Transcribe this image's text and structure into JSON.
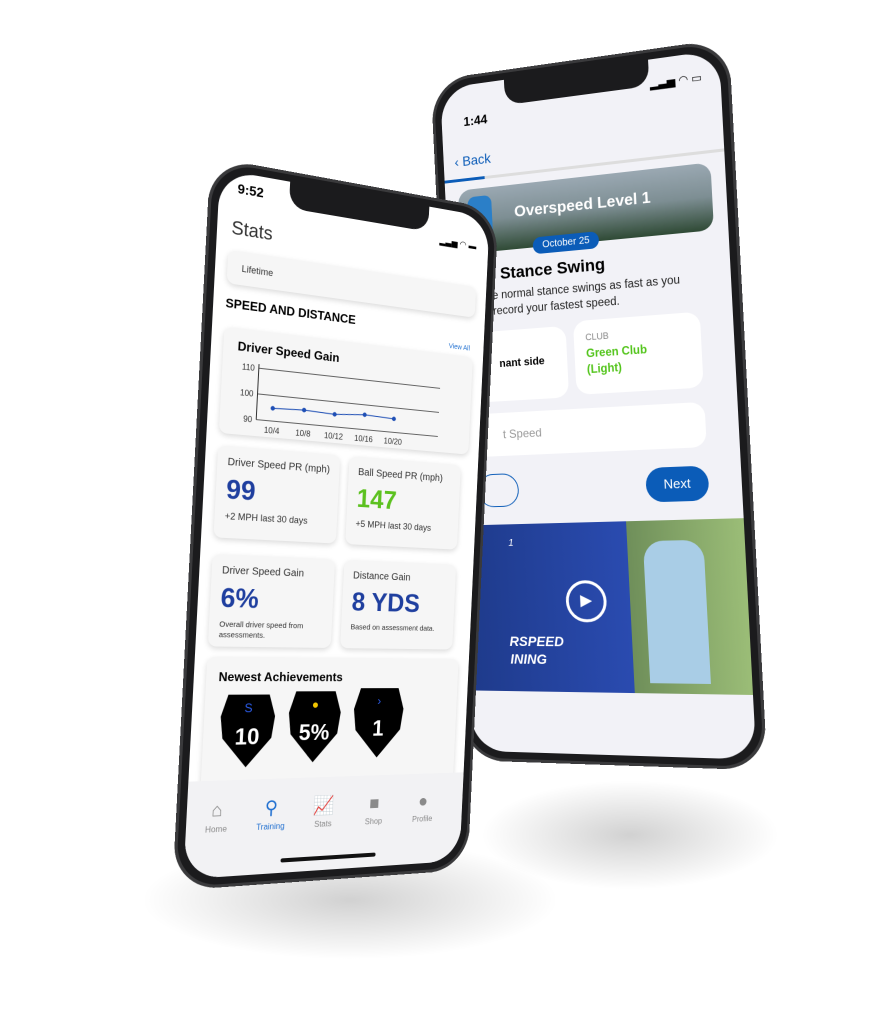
{
  "stats_phone": {
    "status": {
      "time": "9:52"
    },
    "title": "Stats",
    "period_selector": "Lifetime",
    "section_title": "SPEED AND DISTANCE",
    "view_all": "View All",
    "chart_card_title": "Driver Speed Gain",
    "chart_data": {
      "type": "line",
      "x": [
        "10/4",
        "10/8",
        "10/12",
        "10/16",
        "10/20"
      ],
      "values": [
        95,
        95.5,
        95,
        96,
        95.5
      ],
      "yticks": [
        "110",
        "100",
        "90"
      ],
      "ylim": [
        90,
        110
      ],
      "grid": true,
      "color": "#1f4fb5"
    },
    "cards": [
      {
        "label": "Driver Speed PR (mph)",
        "value": "99",
        "note": "+2 MPH last 30 days",
        "color": "#1f3f9f"
      },
      {
        "label": "Ball Speed PR (mph)",
        "value": "147",
        "note": "+5 MPH last 30 days",
        "color": "#5cc11f"
      },
      {
        "label": "Driver Speed Gain",
        "value": "6%",
        "note": "Overall driver speed from assessments.",
        "color": "#1f3f9f"
      },
      {
        "label": "Distance Gain",
        "value": "8 YDS",
        "note": "Based on assessment data.",
        "color": "#1f3f9f"
      }
    ],
    "achievements_title": "Newest Achievements",
    "achievements": [
      {
        "value": "10",
        "icon": "swirl-icon",
        "color": "#2d5ff0"
      },
      {
        "value": "5%",
        "icon": "bomb-icon",
        "color": "#f2c500"
      },
      {
        "value": "1",
        "icon": "chevron-icon",
        "color": "#2d5ff0"
      }
    ],
    "tabs": [
      {
        "label": "Home",
        "icon": "home-icon",
        "active": false
      },
      {
        "label": "Training",
        "icon": "training-icon",
        "active": true
      },
      {
        "label": "Stats",
        "icon": "chart-icon",
        "active": false
      },
      {
        "label": "Shop",
        "icon": "bag-icon",
        "active": false
      },
      {
        "label": "Profile",
        "icon": "profile-icon",
        "active": false
      }
    ],
    "accent": "#1f6fd0"
  },
  "training_phone": {
    "status": {
      "time": "1:44"
    },
    "back_label": "Back",
    "progress": 0.15,
    "banner_title": "Overspeed Level 1",
    "date_pill": "October 25",
    "drill_title": "l Stance Swing",
    "description_1": "e normal stance swings as fast as you",
    "description_2": "record your fastest speed.",
    "side_card_value": "nant side",
    "club_label": "CLUB",
    "club_value_1": "Green Club",
    "club_value_2": "(Light)",
    "speed_placeholder": "t Speed",
    "next_label": "Next",
    "video_number": "1",
    "video_text_1": "RSPEED",
    "video_text_2": "INING",
    "accent": "#0b5cb8",
    "club_color": "#52c41a"
  }
}
